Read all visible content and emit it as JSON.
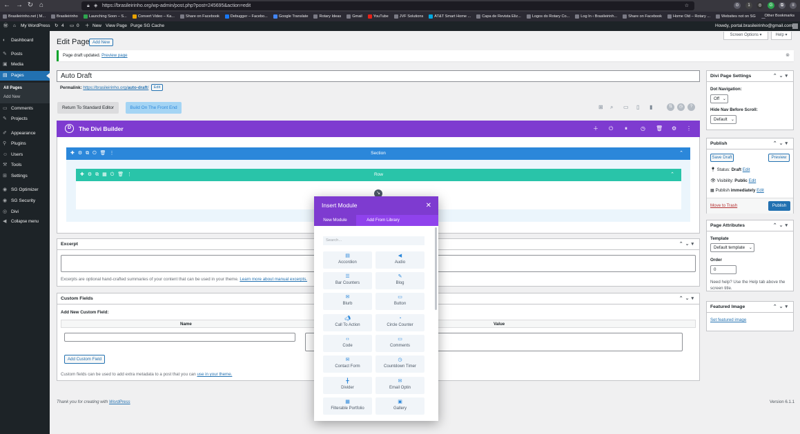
{
  "browser": {
    "url": "https://brasileirinho.org/wp-admin/post.php?post=245695&action=edit",
    "bookmarks": [
      "Brasileirinho.net | M...",
      "Brasileirinho",
      "Launching Soon – S...",
      "Convert Video – Ka...",
      "Share on Facebook",
      "Debugger – Facebo...",
      "Google Translate",
      "Rotary Ideas",
      "Gmail",
      "YouTube",
      "JVF Solutions",
      "AT&T Smart Home ...",
      "Capa de Revista Eliz...",
      "Logos do Rotary Co...",
      "Log In ‹ Brasileirinh...",
      "Share on Facebook",
      "Home Old – Rotary ...",
      "Websites not on SG",
      "Websites"
    ],
    "other_bookmarks": "Other Bookmarks"
  },
  "adminbar": {
    "site": "My WordPress",
    "updates": "4",
    "comments": "0",
    "new": "New",
    "view_page": "View Page",
    "purge": "Purge SG Cache",
    "howdy": "Howdy, portal.brasileirinho@gmail.com"
  },
  "sidebar": {
    "items": [
      {
        "label": "Dashboard",
        "icon": "dashboard-icon"
      },
      {
        "label": "Posts",
        "icon": "pin-icon"
      },
      {
        "label": "Media",
        "icon": "media-icon"
      },
      {
        "label": "Pages",
        "icon": "pages-icon"
      },
      {
        "label": "Comments",
        "icon": "comments-icon"
      },
      {
        "label": "Projects",
        "icon": "pin-icon"
      },
      {
        "label": "Appearance",
        "icon": "appearance-icon"
      },
      {
        "label": "Plugins",
        "icon": "plugins-icon"
      },
      {
        "label": "Users",
        "icon": "users-icon"
      },
      {
        "label": "Tools",
        "icon": "tools-icon"
      },
      {
        "label": "Settings",
        "icon": "settings-icon"
      },
      {
        "label": "SG Optimizer",
        "icon": "sg-icon"
      },
      {
        "label": "SG Security",
        "icon": "sg-icon"
      },
      {
        "label": "Divi",
        "icon": "divi-icon"
      },
      {
        "label": "Collapse menu",
        "icon": "collapse-icon"
      }
    ],
    "submenu": [
      "All Pages",
      "Add New"
    ]
  },
  "top_right": {
    "screen_options": "Screen Options ▾",
    "help": "Help ▾"
  },
  "page": {
    "heading": "Edit Page",
    "add_new": "Add New",
    "notice": "Page draft updated.",
    "notice_link": "Preview page",
    "title_value": "Auto Draft",
    "permalink_label": "Permalink:",
    "permalink_base": "https://brasileirinho.org/",
    "permalink_slug": "auto-draft",
    "permalink_tail": "/",
    "edit": "Edit",
    "return_std": "Return To Standard Editor",
    "front_end": "Build On The Front End"
  },
  "divi": {
    "title": "The Divi Builder",
    "section": "Section",
    "row": "Row"
  },
  "modal": {
    "title": "Insert Module",
    "tabs": [
      "New Module",
      "Add From Library"
    ],
    "search_placeholder": "Search...",
    "modules": [
      {
        "name": "Accordion",
        "icon": "accordion-icon"
      },
      {
        "name": "Audio",
        "icon": "audio-icon"
      },
      {
        "name": "Bar Counters",
        "icon": "bar-counters-icon"
      },
      {
        "name": "Blog",
        "icon": "blog-icon"
      },
      {
        "name": "Blurb",
        "icon": "blurb-icon"
      },
      {
        "name": "Button",
        "icon": "button-icon"
      },
      {
        "name": "Call To Action",
        "icon": "cta-icon"
      },
      {
        "name": "Circle Counter",
        "icon": "circle-counter-icon"
      },
      {
        "name": "Code",
        "icon": "code-icon"
      },
      {
        "name": "Comments",
        "icon": "comments-icon"
      },
      {
        "name": "Contact Form",
        "icon": "contact-form-icon"
      },
      {
        "name": "Countdown Timer",
        "icon": "countdown-icon"
      },
      {
        "name": "Divider",
        "icon": "divider-icon"
      },
      {
        "name": "Email Optin",
        "icon": "email-optin-icon"
      },
      {
        "name": "Filterable Portfolio",
        "icon": "portfolio-icon"
      },
      {
        "name": "Gallery",
        "icon": "gallery-icon"
      }
    ]
  },
  "excerpt": {
    "title": "Excerpt",
    "help": "Excerpts are optional hand-crafted summaries of your content that can be used in your theme.",
    "help_link": "Learn more about manual excerpts."
  },
  "custom_fields": {
    "title": "Custom Fields",
    "add_new": "Add New Custom Field:",
    "col_name": "Name",
    "col_value": "Value",
    "button": "Add Custom Field",
    "help": "Custom fields can be used to add extra metadata to a post that you can",
    "help_link": "use in your theme."
  },
  "divi_settings": {
    "title": "Divi Page Settings",
    "dot_nav_label": "Dot Navigation:",
    "dot_nav_value": "Off",
    "hide_nav_label": "Hide Nav Before Scroll:",
    "hide_nav_value": "Default"
  },
  "publish": {
    "title": "Publish",
    "save_draft": "Save Draft",
    "preview": "Preview",
    "status": "Status:",
    "status_value": "Draft",
    "visibility": "Visibility:",
    "visibility_value": "Public",
    "publish_label": "Publish",
    "publish_value": "immediately",
    "edit": "Edit",
    "trash": "Move to Trash",
    "publish_btn": "Publish"
  },
  "page_attributes": {
    "title": "Page Attributes",
    "template_label": "Template",
    "template_value": "Default template",
    "order_label": "Order",
    "order_value": "0",
    "help": "Need help? Use the Help tab above the screen title."
  },
  "featured": {
    "title": "Featured Image",
    "link": "Set featured image"
  },
  "footer": {
    "thanks": "Thank you for creating with",
    "wp": "WordPress",
    "version": "Version 6.1.1"
  },
  "colors": {
    "divi_purple": "#7e3bd0",
    "section_blue": "#2b87da",
    "row_green": "#29c4a9",
    "wp_blue": "#2271b1"
  }
}
